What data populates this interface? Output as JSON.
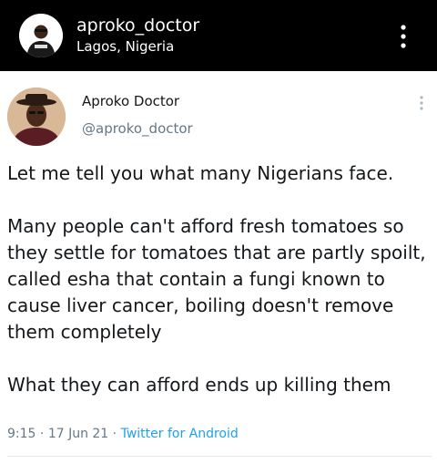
{
  "ig_header": {
    "username": "aproko_doctor",
    "location": "Lagos, Nigeria",
    "more_icon": "vertical-ellipsis-icon"
  },
  "tweet": {
    "display_name": "Aproko Doctor",
    "handle": "@aproko_doctor",
    "more_icon": "vertical-ellipsis-icon",
    "paragraphs": [
      "Let me tell you what many Nigerians face.",
      "Many people can't afford fresh tomatoes so they settle for tomatoes that are partly spoilt, called esha that contain a fungi known to cause liver cancer, boiling doesn't remove them completely",
      "What they can afford ends up killing them"
    ],
    "time": "9:15",
    "separator": " · ",
    "date": "17 Jun 21",
    "source": "Twitter for Android"
  },
  "colors": {
    "header_bg": "#000000",
    "text_primary": "#14171a",
    "text_secondary": "#657786",
    "link": "#1da1f2"
  }
}
